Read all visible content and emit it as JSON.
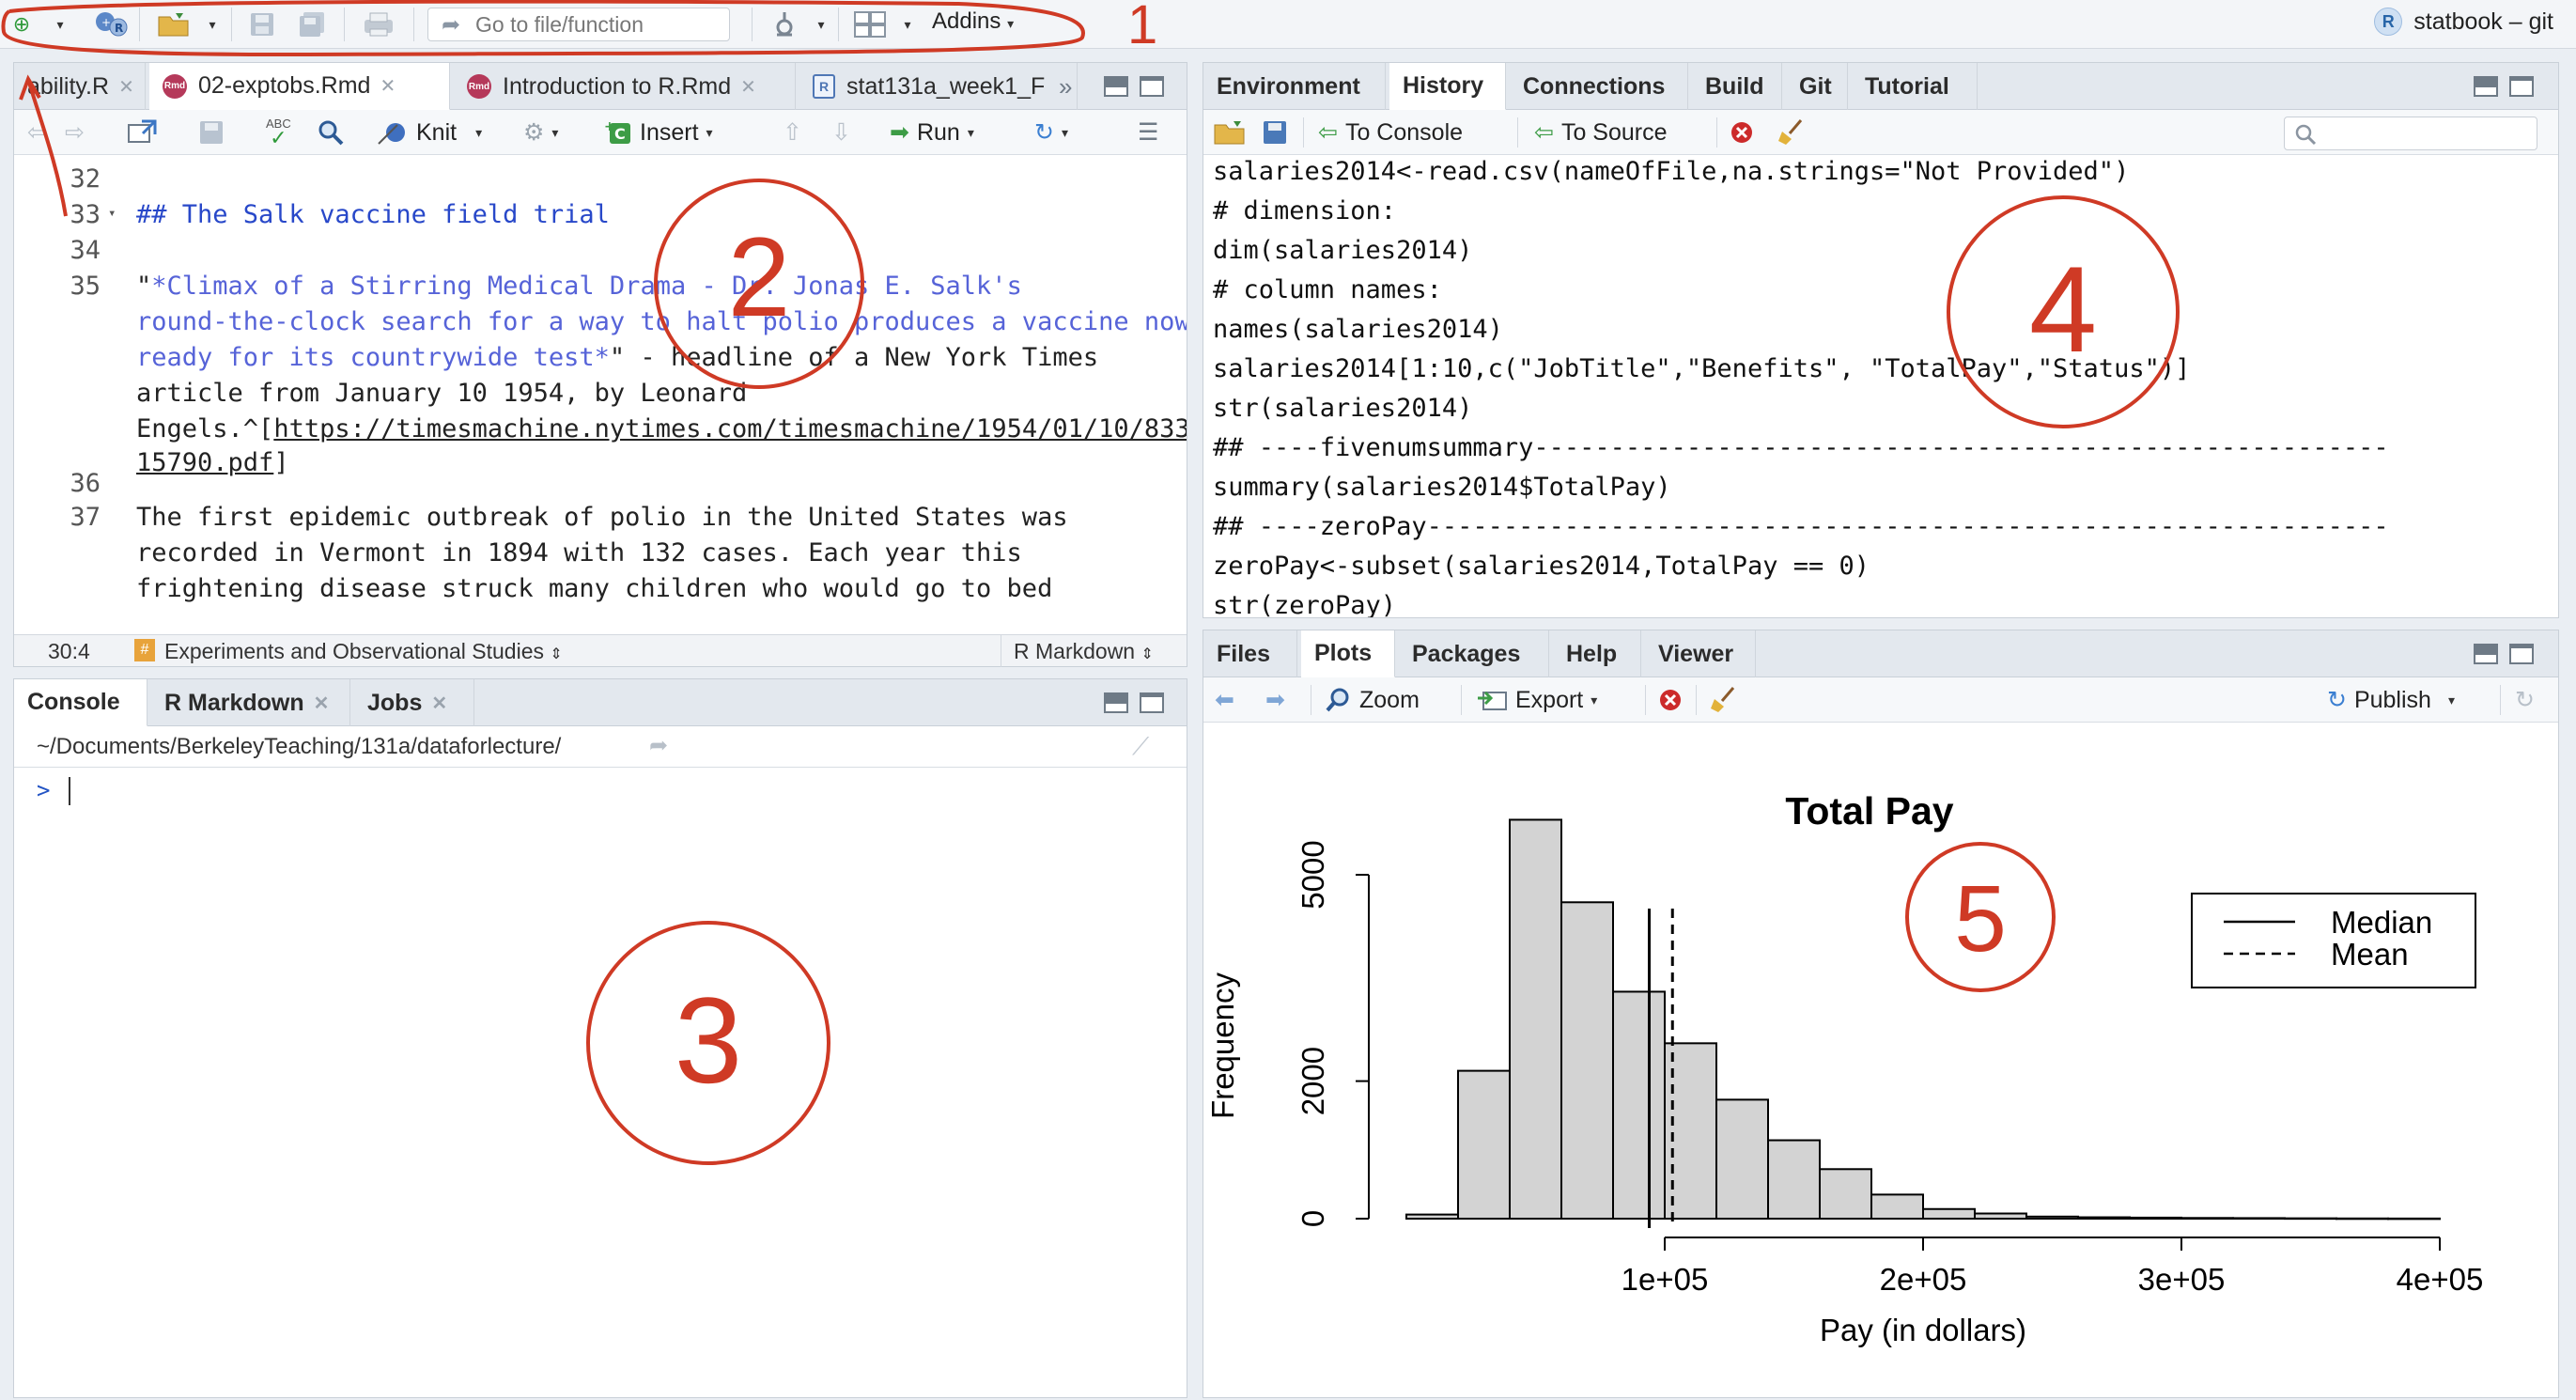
{
  "toolbar": {
    "goto_placeholder": "Go to file/function",
    "addins_label": "Addins",
    "project_label": "statbook – git"
  },
  "source": {
    "tabs": [
      {
        "label": "ability.R"
      },
      {
        "label": "02-exptobs.Rmd"
      },
      {
        "label": "Introduction to R.Rmd"
      },
      {
        "label": "stat131a_week1_F"
      }
    ],
    "toolbar": {
      "knit": "Knit",
      "insert": "Insert",
      "run": "Run",
      "abc": "ABC"
    },
    "line_numbers": [
      "32",
      "33",
      "34",
      "35",
      "36",
      "37"
    ],
    "lines": {
      "l33": "## The Salk vaccine field trial",
      "l35a_q": "\"",
      "l35a": "*Climax of a Stirring Medical Drama - Dr. Jonas E. Salk's",
      "l35b": "round-the-clock search for a way to halt polio produces a vaccine now",
      "l35c_it": "ready for its countrywide test*",
      "l35c_rest": "\" - headline of a New York Times",
      "l35d": "article from January 10 1954, by Leonard",
      "l35e_pre": "Engels.^[",
      "l35e_link": "https://timesmachine.nytimes.com/timesmachine/1954/01/10/833",
      "l35f_link": "15790.pdf",
      "l35f_post": "]",
      "l37a": "The first epidemic outbreak of polio in the United States was",
      "l37b": "recorded in Vermont in 1894 with 132 cases. Each year this",
      "l37c": "frightening disease struck many children who would go to bed"
    },
    "status": {
      "position": "30:4",
      "section": "Experiments and Observational Studies",
      "mode": "R Markdown"
    }
  },
  "console": {
    "tabs": [
      {
        "label": "Console"
      },
      {
        "label": "R Markdown"
      },
      {
        "label": "Jobs"
      }
    ],
    "path": "~/Documents/BerkeleyTeaching/131a/dataforlecture/",
    "prompt": ">"
  },
  "history": {
    "tabs": [
      {
        "label": "Environment"
      },
      {
        "label": "History"
      },
      {
        "label": "Connections"
      },
      {
        "label": "Build"
      },
      {
        "label": "Git"
      },
      {
        "label": "Tutorial"
      }
    ],
    "to_console": "To Console",
    "to_source": "To Source",
    "lines": [
      "salaries2014<-read.csv(nameOfFile,na.strings=\"Not Provided\")",
      "# dimension:",
      "dim(salaries2014)",
      "# column names:",
      "names(salaries2014)",
      "salaries2014[1:10,c(\"JobTitle\",\"Benefits\", \"TotalPay\",\"Status\")]",
      "str(salaries2014)",
      "## ----fivenumsummary--------------------------------------------------------",
      "summary(salaries2014$TotalPay)",
      "## ----zeroPay---------------------------------------------------------------",
      "zeroPay<-subset(salaries2014,TotalPay == 0)",
      "str(zeroPay)"
    ]
  },
  "files": {
    "tabs": [
      {
        "label": "Files"
      },
      {
        "label": "Plots"
      },
      {
        "label": "Packages"
      },
      {
        "label": "Help"
      },
      {
        "label": "Viewer"
      }
    ],
    "zoom": "Zoom",
    "export": "Export",
    "publish": "Publish"
  },
  "annotations": [
    "1",
    "2",
    "3",
    "4",
    "5"
  ],
  "chart_data": {
    "type": "bar",
    "title": "Total Pay",
    "xlabel": "Pay (in dollars)",
    "ylabel": "Frequency",
    "x_ticks": [
      "1e+05",
      "2e+05",
      "3e+05",
      "4e+05"
    ],
    "y_ticks": [
      "0",
      "2000",
      "5000"
    ],
    "xlim": [
      0,
      400000
    ],
    "ylim": [
      0,
      5000
    ],
    "bin_width": 20000,
    "bins_start": [
      0,
      20000,
      40000,
      60000,
      80000,
      100000,
      120000,
      140000,
      160000,
      180000,
      200000,
      220000,
      240000,
      260000,
      280000,
      300000,
      320000,
      340000,
      360000,
      380000
    ],
    "values": [
      60,
      2150,
      5800,
      4600,
      3300,
      2550,
      1730,
      1140,
      720,
      350,
      140,
      75,
      30,
      20,
      15,
      10,
      8,
      5,
      3,
      2
    ],
    "median": 94000,
    "mean": 103000,
    "legend": {
      "entries": [
        "Median",
        "Mean"
      ],
      "placement": "top-right"
    },
    "colors": {
      "bar_fill": "#d3d3d3",
      "bar_stroke": "#000000"
    }
  }
}
